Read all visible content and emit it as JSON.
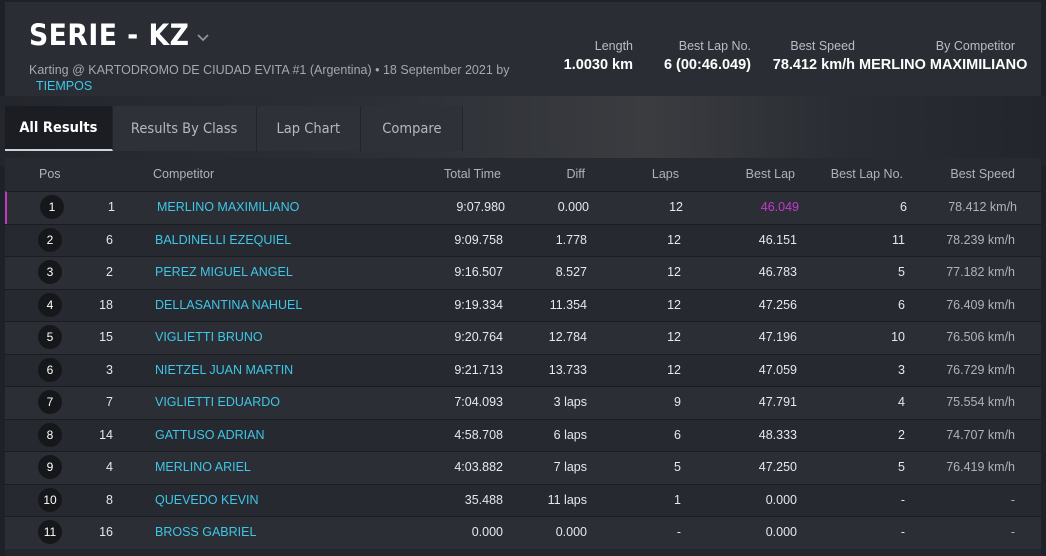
{
  "header": {
    "title": "SERIE - KZ",
    "subtitle_prefix": "Karting @ KARTODROMO DE CIUDAD EVITA #1 (Argentina) • 18 September 2021 by",
    "subtitle_link": "TIEMPOS",
    "stats": {
      "length_label": "Length",
      "length_value": "1.0030 km",
      "best_lap_no_label": "Best Lap No.",
      "best_lap_no_value": "6 (00:46.049)",
      "best_speed_label": "Best Speed",
      "best_speed_value": "78.412 km/h",
      "by_competitor_label": "By Competitor",
      "by_competitor_value": "MERLINO MAXIMILIANO"
    }
  },
  "tabs": [
    "All Results",
    "Results By Class",
    "Lap Chart",
    "Compare"
  ],
  "active_tab": "All Results",
  "table": {
    "columns": {
      "pos": "Pos",
      "competitor": "Competitor",
      "total_time": "Total Time",
      "diff": "Diff",
      "laps": "Laps",
      "best_lap": "Best Lap",
      "best_lap_no": "Best Lap No.",
      "best_speed": "Best Speed"
    },
    "rows": [
      {
        "pos": "1",
        "num": "1",
        "competitor": "MERLINO MAXIMILIANO",
        "total": "9:07.980",
        "diff": "0.000",
        "laps": "12",
        "best": "46.049",
        "best_no": "6",
        "speed": "78.412 km/h"
      },
      {
        "pos": "2",
        "num": "6",
        "competitor": "BALDINELLI EZEQUIEL",
        "total": "9:09.758",
        "diff": "1.778",
        "laps": "12",
        "best": "46.151",
        "best_no": "11",
        "speed": "78.239 km/h"
      },
      {
        "pos": "3",
        "num": "2",
        "competitor": "PEREZ MIGUEL ANGEL",
        "total": "9:16.507",
        "diff": "8.527",
        "laps": "12",
        "best": "46.783",
        "best_no": "5",
        "speed": "77.182 km/h"
      },
      {
        "pos": "4",
        "num": "18",
        "competitor": "DELLASANTINA NAHUEL",
        "total": "9:19.334",
        "diff": "11.354",
        "laps": "12",
        "best": "47.256",
        "best_no": "6",
        "speed": "76.409 km/h"
      },
      {
        "pos": "5",
        "num": "15",
        "competitor": "VIGLIETTI BRUNO",
        "total": "9:20.764",
        "diff": "12.784",
        "laps": "12",
        "best": "47.196",
        "best_no": "10",
        "speed": "76.506 km/h"
      },
      {
        "pos": "6",
        "num": "3",
        "competitor": "NIETZEL JUAN MARTIN",
        "total": "9:21.713",
        "diff": "13.733",
        "laps": "12",
        "best": "47.059",
        "best_no": "3",
        "speed": "76.729 km/h"
      },
      {
        "pos": "7",
        "num": "7",
        "competitor": "VIGLIETTI EDUARDO",
        "total": "7:04.093",
        "diff": "3 laps",
        "laps": "9",
        "best": "47.791",
        "best_no": "4",
        "speed": "75.554 km/h"
      },
      {
        "pos": "8",
        "num": "14",
        "competitor": "GATTUSO ADRIAN",
        "total": "4:58.708",
        "diff": "6 laps",
        "laps": "6",
        "best": "48.333",
        "best_no": "2",
        "speed": "74.707 km/h"
      },
      {
        "pos": "9",
        "num": "4",
        "competitor": "MERLINO ARIEL",
        "total": "4:03.882",
        "diff": "7 laps",
        "laps": "5",
        "best": "47.250",
        "best_no": "5",
        "speed": "76.419 km/h"
      },
      {
        "pos": "10",
        "num": "8",
        "competitor": "QUEVEDO KEVIN",
        "total": "35.488",
        "diff": "11 laps",
        "laps": "1",
        "best": "0.000",
        "best_no": "-",
        "speed": "-"
      },
      {
        "pos": "11",
        "num": "16",
        "competitor": "BROSS GABRIEL",
        "total": "0.000",
        "diff": "0.000",
        "laps": "-",
        "best": "0.000",
        "best_no": "-",
        "speed": "-"
      }
    ]
  },
  "colors": {
    "accent_link": "#3ec7e8",
    "best_lap_highlight": "#c53ad0",
    "background": "#1e2127"
  },
  "icons": {
    "title_dropdown": "chevron-down-icon"
  }
}
